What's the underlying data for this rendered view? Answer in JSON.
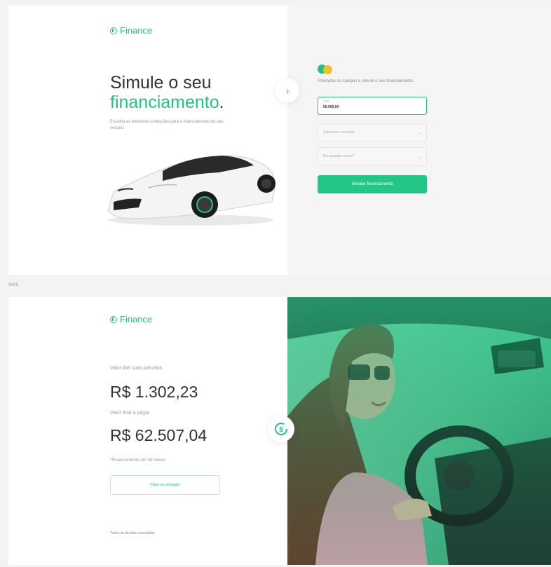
{
  "brand": {
    "name": "Finance",
    "accent": "#1fc483"
  },
  "screen1": {
    "title_line1": "Simule o seu",
    "title_line2": "financiamento",
    "title_dot": ".",
    "subtitle": "Escolha as melhores condições para o financiamento do seu veículo.",
    "next_icon": "chevron-right-icon",
    "next_glyph": "›",
    "form": {
      "intro": "Preencha os campos e simule o seu financiamento.",
      "value_label": "Valor",
      "value": "50.000,00",
      "entry_placeholder": "Selecione a entrada",
      "installments_placeholder": "Em quantas vezes?",
      "chevron_glyph": "⌄",
      "submit_label": "Simular financiamento"
    }
  },
  "frame_label": "Web",
  "screen2": {
    "installment_label": "Valor das suas parcelas",
    "installment_value": "R$ 1.302,23",
    "total_label": "Valor final a pagar",
    "total_value": "R$ 62.507,04",
    "note": "*Financiamento em 48 meses",
    "back_button": "Voltar ao simulador",
    "footer": "Todos os direitos reservados",
    "badge_icon": "refresh-dollar-icon"
  }
}
